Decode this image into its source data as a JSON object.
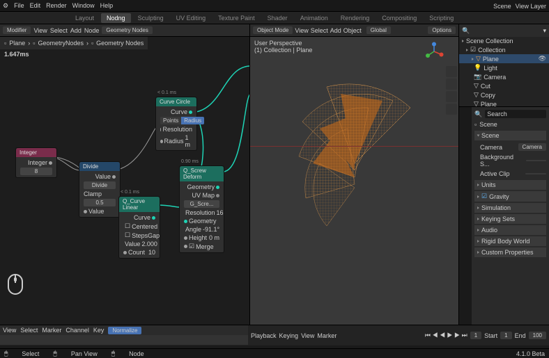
{
  "topmenu": [
    "File",
    "Edit",
    "Render",
    "Window",
    "Help"
  ],
  "tabs": [
    "Layout",
    "Nodng",
    "Sculpting",
    "UV Editing",
    "Texture Paint",
    "Shader",
    "Animation",
    "Rendering",
    "Compositing",
    "Scripting"
  ],
  "active_tab": 1,
  "scene_label": "Scene",
  "viewlayer_label": "View Layer",
  "modifier_bar": {
    "modifier": "Modifier",
    "view": "View",
    "select": "Select",
    "add": "Add",
    "node": "Node",
    "geonodes": "Geometry Nodes"
  },
  "breadcrumb": [
    "Plane",
    "GeometryNodes",
    "Geometry Nodes"
  ],
  "timing": "1.647ms",
  "nodes": {
    "integer": {
      "title": "Integer",
      "label": "Integer",
      "value": "8",
      "time": ""
    },
    "divide": {
      "title": "Divide",
      "op": "Divide",
      "clamp": "Clamp",
      "value": "0.5",
      "out": "Value",
      "in": "Value",
      "time": ""
    },
    "curve_circle": {
      "title": "Curve Circle",
      "time": "< 0.1 ms",
      "mode_points": "Points",
      "mode_radius": "Radius",
      "out": "Curve",
      "resolution": "Resolution",
      "radius": "Radius",
      "radius_val": "1 m"
    },
    "curve_linear": {
      "title": "Q_Curve Linear",
      "time": "< 0.1 ms",
      "out": "Curve",
      "centered": "Centered",
      "stepsgap": "StepsGap",
      "value_label": "Value",
      "value": "2.000",
      "count_label": "Count",
      "count": "10"
    },
    "screw": {
      "title": "Q_Screw Deform",
      "time": "0.90 ms",
      "geometry": "Geometry",
      "uvmap": "UV Map",
      "gscrew": "G_Scre...",
      "resolution": "Resolution",
      "res_val": "16",
      "geo_in": "Geometry",
      "angle": "Angle",
      "angle_val": "-91.1°",
      "height": "Height",
      "height_val": "0 m",
      "merge": "Merge"
    }
  },
  "viewport": {
    "mode": "Object Mode",
    "view": "View",
    "select": "Select",
    "add": "Add",
    "object": "Object",
    "global": "Global",
    "options": "Options",
    "persp": "User Perspective",
    "obj": "(1) Collection | Plane"
  },
  "outliner": {
    "scene_collection": "Scene Collection",
    "collection": "Collection",
    "items": [
      "Plane",
      "Light",
      "Camera",
      "Cut",
      "Copy",
      "Plane"
    ]
  },
  "props": {
    "search": "Search",
    "scene": "Scene",
    "scene_panel": "Scene",
    "camera": "Camera",
    "camera_val": "Camera",
    "background_s": "Background S...",
    "active_clip": "Active Clip",
    "units": "Units",
    "gravity": "Gravity",
    "simulation": "Simulation",
    "keying": "Keying Sets",
    "audio": "Audio",
    "rigid": "Rigid Body World",
    "custom": "Custom Properties"
  },
  "dopesheet": {
    "view": "View",
    "select": "Select",
    "marker": "Marker",
    "channel": "Channel",
    "key": "Key",
    "normalize": "Normalize"
  },
  "timeline": {
    "playback": "Playback",
    "keying": "Keying",
    "view": "View",
    "marker": "Marker",
    "start": "Start",
    "start_val": "1",
    "end": "End",
    "end_val": "100",
    "frame": "1"
  },
  "footer": {
    "select": "Select",
    "pan": "Pan View",
    "node": "Node",
    "version": "4.1.0 Beta"
  }
}
